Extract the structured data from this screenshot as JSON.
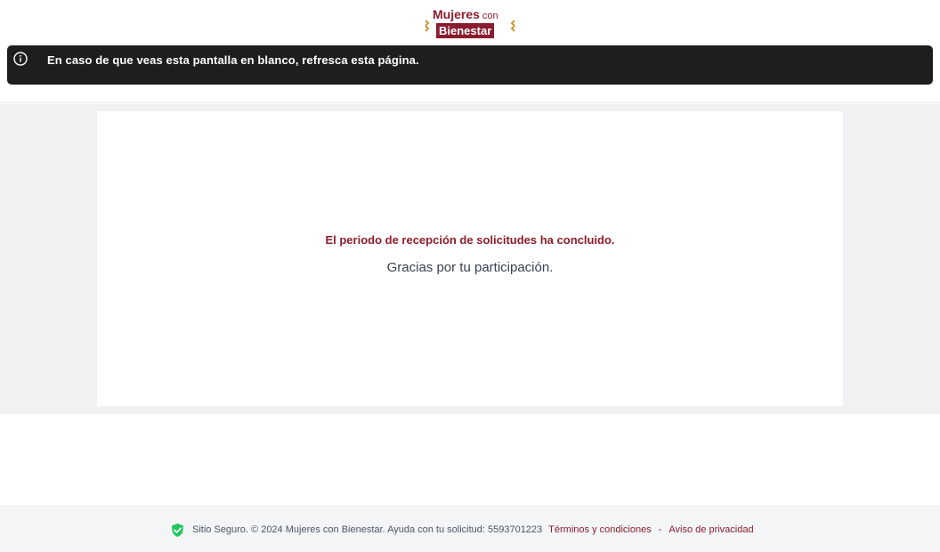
{
  "header": {
    "logo": {
      "line1": "Mujeres",
      "line1_small": "con",
      "line2": "Bienestar"
    }
  },
  "banner": {
    "icon": "info-icon",
    "text": "En caso de que veas esta pantalla en blanco, refresca esta página."
  },
  "main": {
    "title": "El periodo de recepción de solicitudes ha concluido.",
    "subtitle": "Gracias por tu participación."
  },
  "footer": {
    "icon": "shield-check-icon",
    "text": "Sitio Seguro. © 2024 Mujeres con Bienestar. Ayuda con tu solicitud: 5593701223",
    "terms_link": "Términos y condiciones",
    "separator": "-",
    "privacy_link": "Aviso de privacidad"
  },
  "colors": {
    "brand": "#8a1c2e",
    "gold": "#c99a3b",
    "banner_bg": "#1e1e1e",
    "main_bg": "#f0f1f3",
    "shield_green": "#22c55e"
  }
}
